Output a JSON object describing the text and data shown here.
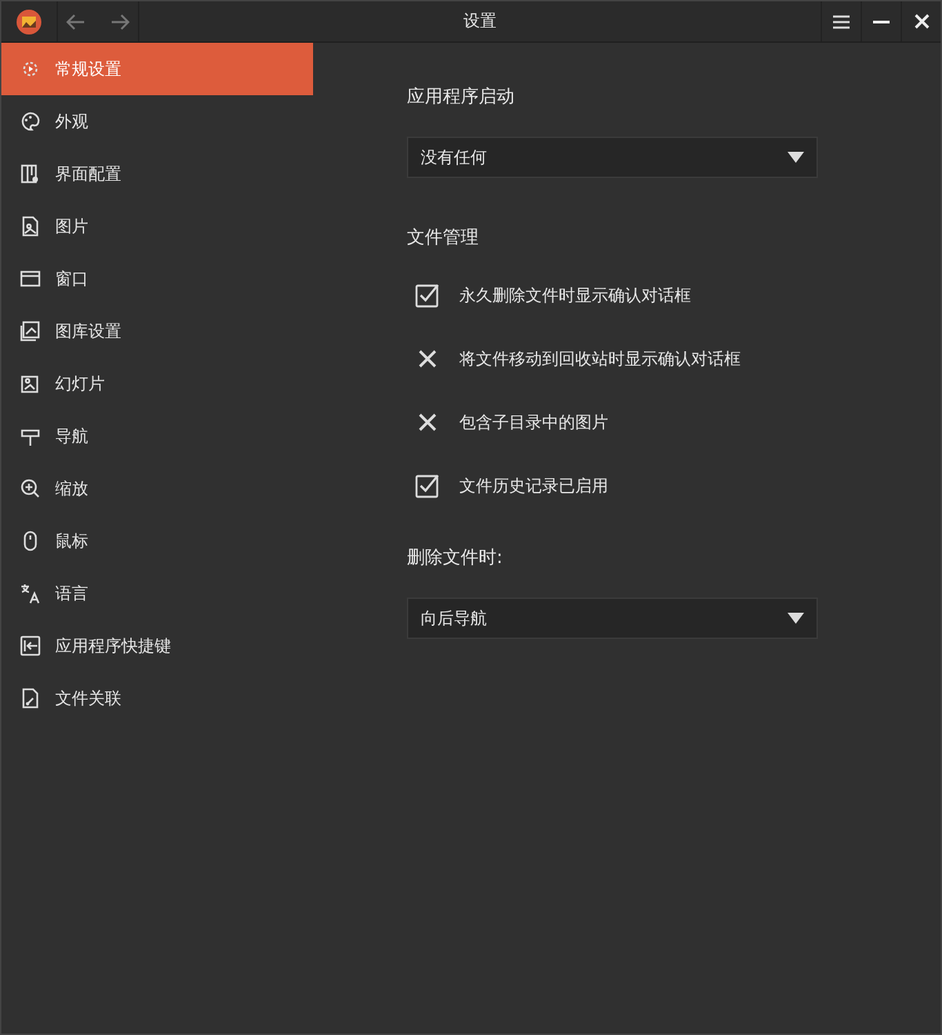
{
  "window": {
    "title": "设置"
  },
  "sidebar": {
    "items": [
      {
        "label": "常规设置",
        "selected": true
      },
      {
        "label": "外观",
        "selected": false
      },
      {
        "label": "界面配置",
        "selected": false
      },
      {
        "label": "图片",
        "selected": false
      },
      {
        "label": "窗口",
        "selected": false
      },
      {
        "label": "图库设置",
        "selected": false
      },
      {
        "label": "幻灯片",
        "selected": false
      },
      {
        "label": "导航",
        "selected": false
      },
      {
        "label": "缩放",
        "selected": false
      },
      {
        "label": "鼠标",
        "selected": false
      },
      {
        "label": "语言",
        "selected": false
      },
      {
        "label": "应用程序快捷键",
        "selected": false
      },
      {
        "label": "文件关联",
        "selected": false
      }
    ]
  },
  "startup": {
    "heading": "应用程序启动",
    "dropdown": "没有任何"
  },
  "file_management": {
    "heading": "文件管理",
    "options": [
      {
        "label": "永久删除文件时显示确认对话框",
        "checked": true
      },
      {
        "label": "将文件移动到回收站时显示确认对话框",
        "checked": false
      },
      {
        "label": "包含子目录中的图片",
        "checked": false
      },
      {
        "label": "文件历史记录已启用",
        "checked": true
      }
    ]
  },
  "on_delete": {
    "heading": "删除文件时:",
    "dropdown": "向后导航"
  }
}
